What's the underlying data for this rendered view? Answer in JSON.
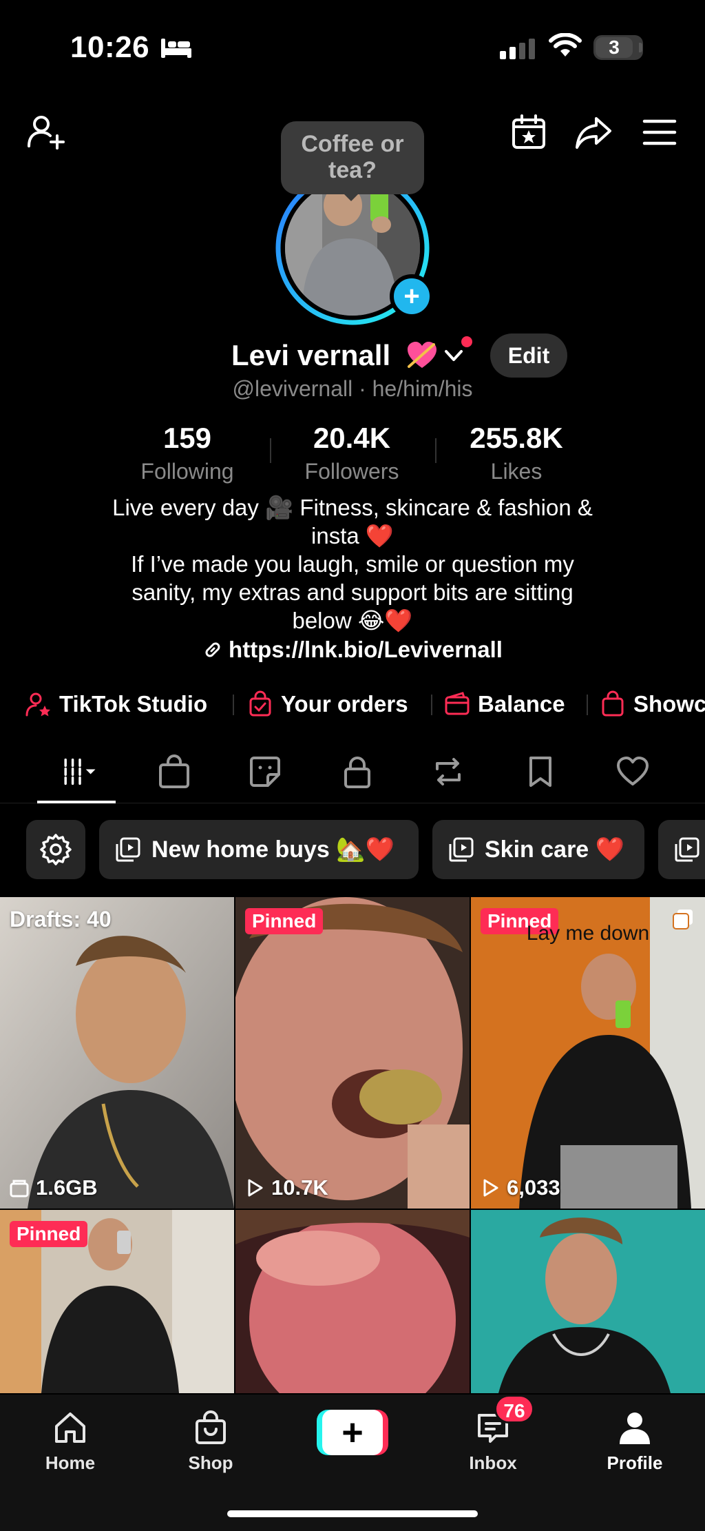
{
  "status_bar": {
    "time": "10:26",
    "battery": "3"
  },
  "header": {
    "bubble_text": "Coffee or tea?"
  },
  "profile": {
    "display_name": "Levi vernall",
    "handle": "@levivernall · he/him/his",
    "edit_label": "Edit",
    "stats": [
      {
        "value": "159",
        "label": "Following"
      },
      {
        "value": "20.4K",
        "label": "Followers"
      },
      {
        "value": "255.8K",
        "label": "Likes"
      }
    ],
    "bio_lines": [
      "Live every day 🎥 Fitness, skincare & fashion &",
      "insta ❤️",
      "If I’ve made you laugh, smile or question my",
      "sanity, my extras and support bits are sitting",
      "below 😂❤️"
    ],
    "link": "https://lnk.bio/Levivernall"
  },
  "shortcuts": [
    {
      "label": "TikTok Studio",
      "icon": "person-star-icon"
    },
    {
      "label": "Your orders",
      "icon": "shopping-bag-check-icon"
    },
    {
      "label": "Balance",
      "icon": "wallet-icon"
    },
    {
      "label": "Showc",
      "icon": "bag-icon"
    }
  ],
  "tabs": [
    {
      "icon": "grid-icon",
      "active": true
    },
    {
      "icon": "shop-bag-icon"
    },
    {
      "icon": "sticker-icon"
    },
    {
      "icon": "lock-icon"
    },
    {
      "icon": "repost-icon"
    },
    {
      "icon": "bookmark-icon"
    },
    {
      "icon": "heart-icon"
    }
  ],
  "chips": [
    {
      "label": "New home buys 🏡❤️"
    },
    {
      "label": "Skin care ❤️"
    }
  ],
  "videos": [
    {
      "label": "Drafts: 40",
      "stat": "1.6GB"
    },
    {
      "pinned": "Pinned",
      "stat": "10.7K"
    },
    {
      "pinned": "Pinned",
      "caption": "Lay me down",
      "stat": "6,033"
    },
    {
      "pinned": "Pinned"
    },
    {},
    {}
  ],
  "nav": {
    "items": [
      {
        "label": "Home",
        "icon": "home-icon"
      },
      {
        "label": "Shop",
        "icon": "shop-icon"
      },
      {
        "label": "Inbox",
        "icon": "inbox-icon"
      },
      {
        "label": "Profile",
        "icon": "profile-icon"
      }
    ],
    "create_label": "+",
    "inbox_badge": "76"
  },
  "colors": {
    "accent": "#fe2c55",
    "cyan": "#25f4ee",
    "ring": "#21b7ee",
    "background": "#000000"
  }
}
